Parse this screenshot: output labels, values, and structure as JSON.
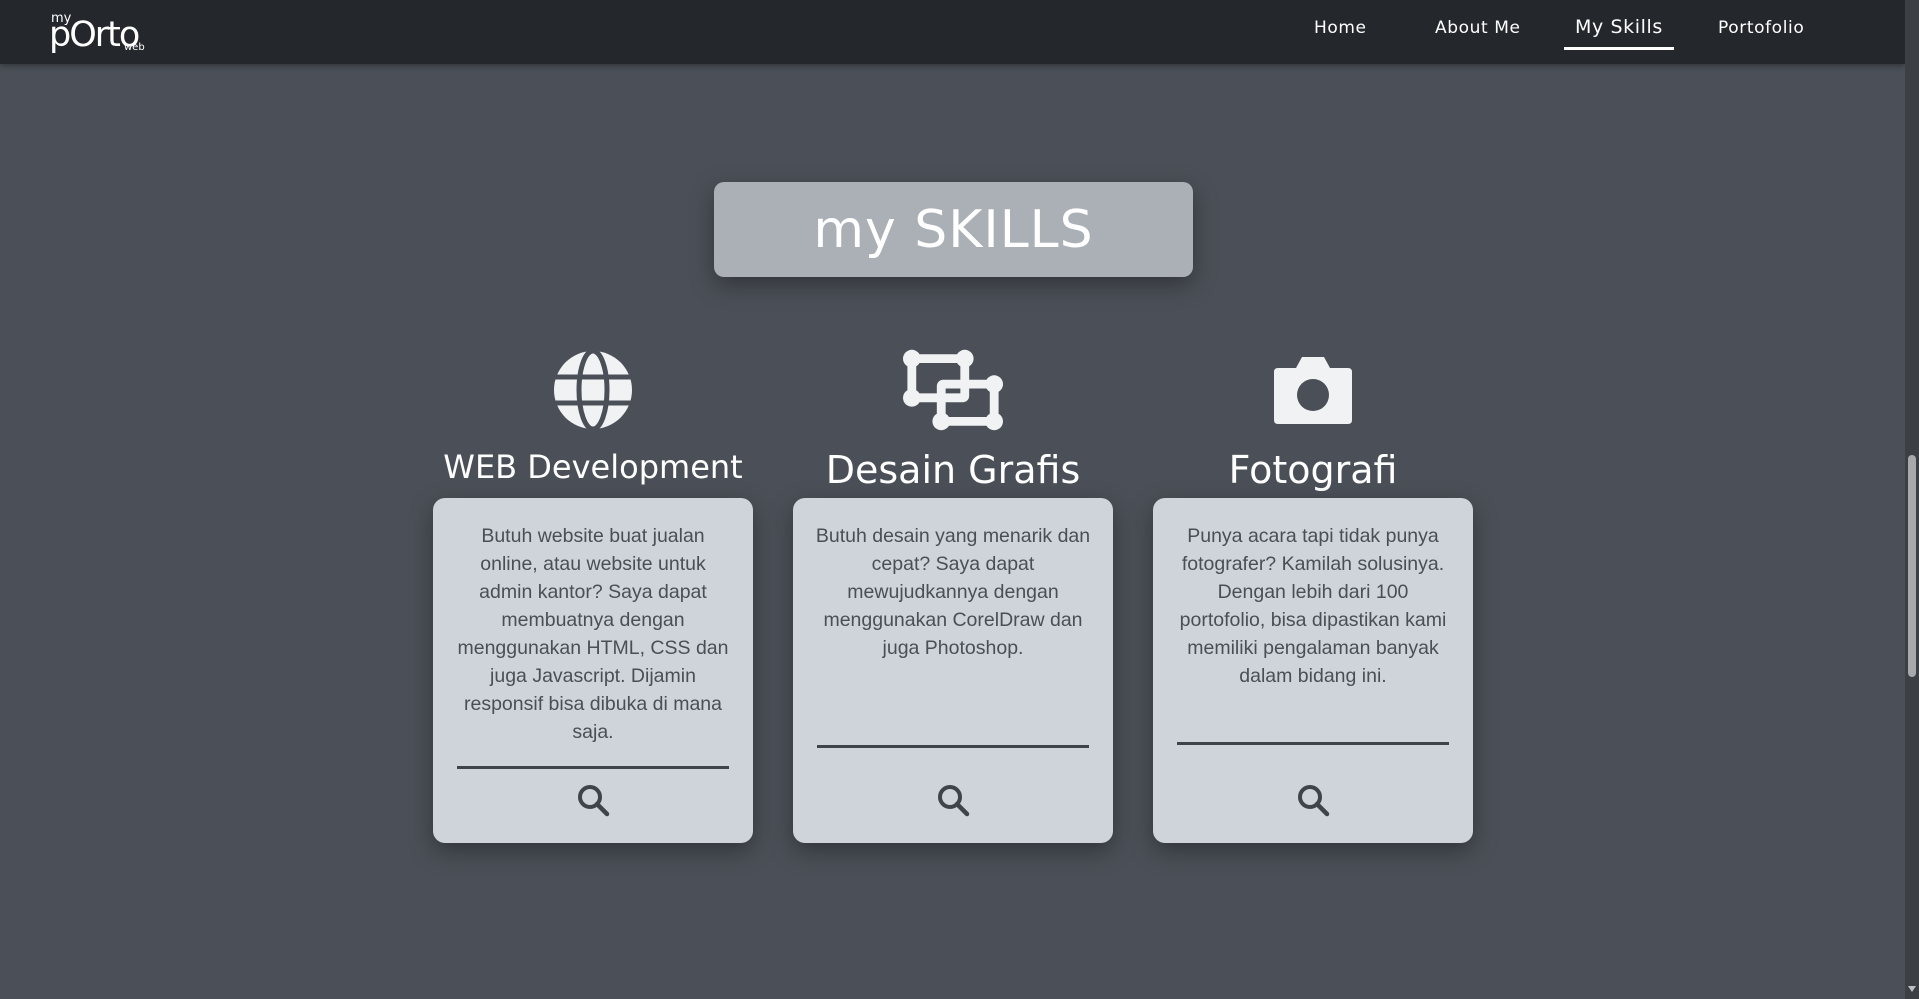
{
  "logo": {
    "my": "my",
    "porto": "pOrto",
    "web": "web"
  },
  "nav": {
    "items": [
      {
        "label": "Home"
      },
      {
        "label": "About Me"
      },
      {
        "label": "My Skills",
        "active": true
      },
      {
        "label": "Portofolio"
      }
    ]
  },
  "section": {
    "title": "my SKILLS"
  },
  "skills": [
    {
      "icon": "globe-icon",
      "title": "WEB Development",
      "description": "Butuh website buat jualan online, atau website untuk admin kantor? Saya dapat membuatnya dengan menggunakan HTML, CSS dan juga Javascript. Dijamin responsif bisa dibuka di mana saja.",
      "button_icon": "search-icon"
    },
    {
      "icon": "vector-square-icon",
      "title": "Desain Grafis",
      "description": "Butuh desain yang menarik dan cepat? Saya dapat mewujudkannya dengan menggunakan CorelDraw dan juga Photoshop.",
      "button_icon": "search-icon"
    },
    {
      "icon": "camera-icon",
      "title": "Fotografi",
      "description": "Punya acara tapi tidak punya fotografer? Kamilah solusinya. Dengan lebih dari 100 portofolio, bisa dipastikan kami memiliki pengalaman banyak dalam bidang ini.",
      "button_icon": "search-icon"
    }
  ],
  "colors": {
    "background": "#4b5058",
    "navbar": "#24272c",
    "card": "#cfd3da",
    "title_box": "#abafb6",
    "text_dark": "#4a4f57"
  }
}
